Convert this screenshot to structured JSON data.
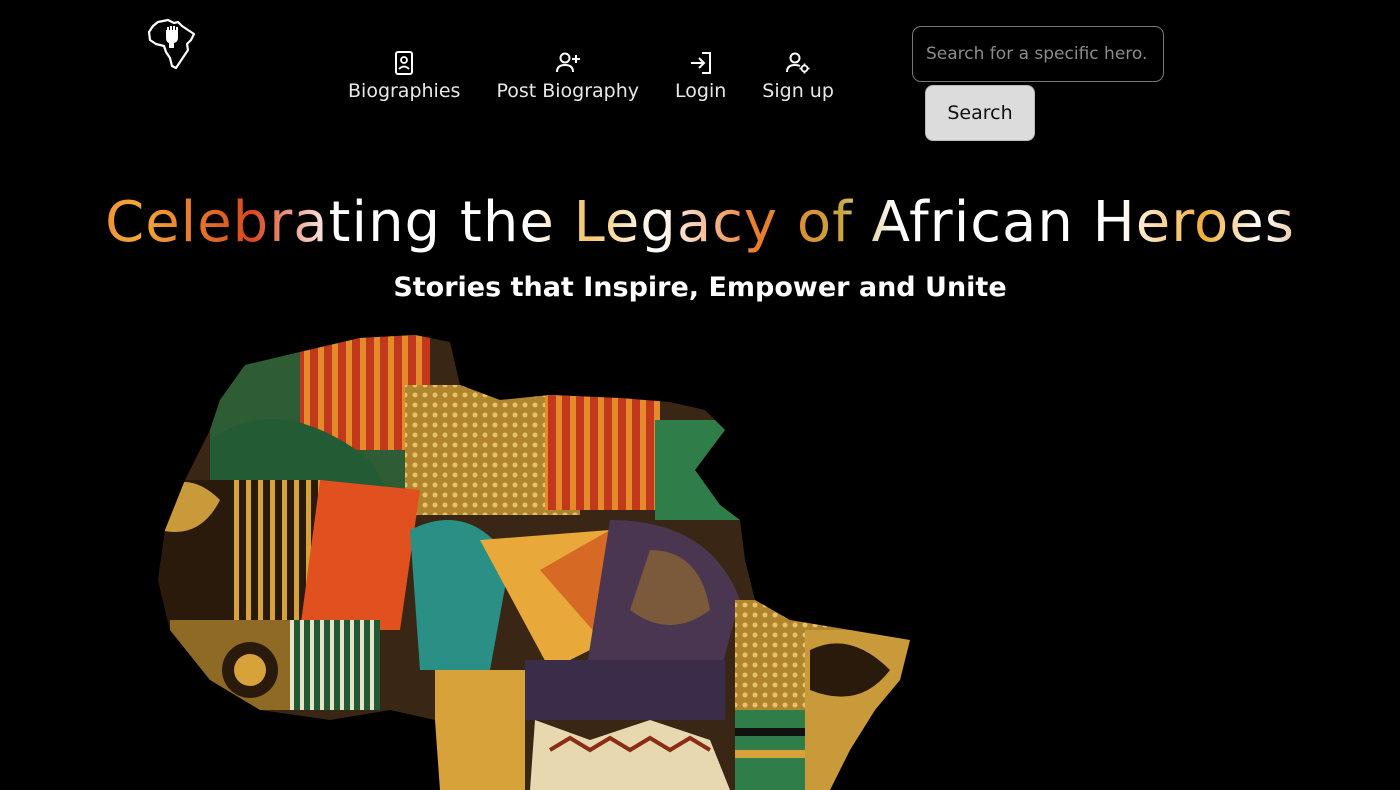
{
  "nav": {
    "items": [
      {
        "label": "Biographies",
        "icon": "biography-card-icon"
      },
      {
        "label": "Post Biography",
        "icon": "add-user-icon"
      },
      {
        "label": "Login",
        "icon": "login-icon"
      },
      {
        "label": "Sign up",
        "icon": "user-gear-icon"
      }
    ]
  },
  "search": {
    "placeholder": "Search for a specific hero.",
    "value": "",
    "button_label": "Search"
  },
  "hero": {
    "title": "Celebrating the Legacy of African Heroes",
    "subtitle": "Stories that Inspire, Empower and Unite"
  },
  "colors": {
    "background": "#000000",
    "search_button": "#dcdcdc",
    "accent_orange": "#e8582a",
    "accent_gold": "#f2a838",
    "accent_green": "#2e6b3a",
    "accent_teal": "#2a8f85"
  }
}
